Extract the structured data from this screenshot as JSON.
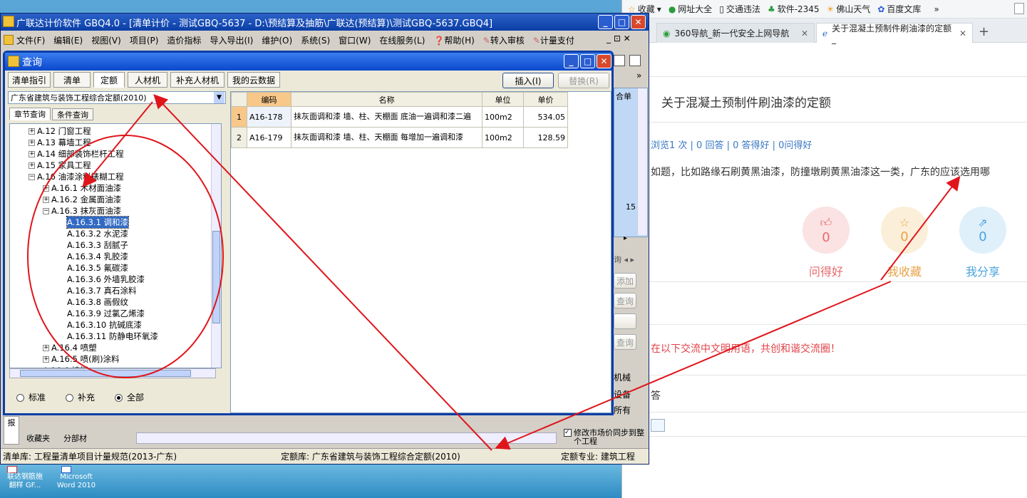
{
  "app": {
    "title": "广联达计价软件 GBQ4.0 - [清单计价 - 测试GBQ-5637 - D:\\预结算及抽筋\\广联达(预结算)\\测试GBQ-5637.GBQ4]",
    "menu": [
      "文件(F)",
      "编辑(E)",
      "视图(V)",
      "项目(P)",
      "造价指标",
      "导入导出(I)",
      "维护(O)",
      "系统(S)",
      "窗口(W)",
      "在线服务(L)",
      "帮助(H)",
      "转入审核",
      "计量支付"
    ],
    "status": {
      "qd_lib": "清单库: 工程量清单项目计量规范(2013-广东)",
      "de_lib": "定额库: 广东省建筑与装饰工程综合定额(2010)",
      "de_major": "定额专业: 建筑工程"
    },
    "bottom_tabs": [
      "收藏夹",
      "分部材"
    ],
    "side_right": {
      "label_he": "合单",
      "num": "15",
      "chaxun": "询",
      "tianjia": "添加",
      "chaxun2": "查询",
      "chaxun3": "查询",
      "radio_jixie": "机械",
      "radio_shebei": "设备",
      "radio_suoyou": "所有",
      "sync_label": "修改市场价同步到整个工程"
    },
    "left_vertical": "报"
  },
  "dialog": {
    "title": "查询",
    "tabs": [
      "清单指引",
      "清单",
      "定额",
      "人材机",
      "补充人材机",
      "我的云数据"
    ],
    "insert": "插入(I)",
    "replace": "替换(R)",
    "combo_value": "广东省建筑与装饰工程综合定额(2010)",
    "subtabs": [
      "章节查询",
      "条件查询"
    ],
    "tree": [
      {
        "label": "A.12 门窗工程",
        "lvl": 1,
        "tog": "+"
      },
      {
        "label": "A.13 幕墙工程",
        "lvl": 1,
        "tog": "+"
      },
      {
        "label": "A.14 细部装饰栏杆工程",
        "lvl": 1,
        "tog": "+"
      },
      {
        "label": "A.15 家具工程",
        "lvl": 1,
        "tog": "+"
      },
      {
        "label": "A.16 油漆涂料裱糊工程",
        "lvl": 1,
        "tog": "-"
      },
      {
        "label": "A.16.1 木材面油漆",
        "lvl": 2,
        "tog": "+"
      },
      {
        "label": "A.16.2 金属面油漆",
        "lvl": 2,
        "tog": "+"
      },
      {
        "label": "A.16.3 抹灰面油漆",
        "lvl": 2,
        "tog": "-"
      },
      {
        "label": "A.16.3.1 调和漆",
        "lvl": 3,
        "tog": "",
        "sel": true
      },
      {
        "label": "A.16.3.2 水泥漆",
        "lvl": 3,
        "tog": ""
      },
      {
        "label": "A.16.3.3 刮腻子",
        "lvl": 3,
        "tog": ""
      },
      {
        "label": "A.16.3.4 乳胶漆",
        "lvl": 3,
        "tog": ""
      },
      {
        "label": "A.16.3.5 氟碳漆",
        "lvl": 3,
        "tog": ""
      },
      {
        "label": "A.16.3.6 外墙乳胶漆",
        "lvl": 3,
        "tog": ""
      },
      {
        "label": "A.16.3.7 真石涂料",
        "lvl": 3,
        "tog": ""
      },
      {
        "label": "A.16.3.8 画假纹",
        "lvl": 3,
        "tog": ""
      },
      {
        "label": "A.16.3.9 过氯乙烯漆",
        "lvl": 3,
        "tog": ""
      },
      {
        "label": "A.16.3.10 抗碱底漆",
        "lvl": 3,
        "tog": ""
      },
      {
        "label": "A.16.3.11 防静电环氧漆",
        "lvl": 3,
        "tog": ""
      },
      {
        "label": "A.16.4 喷塑",
        "lvl": 2,
        "tog": "+"
      },
      {
        "label": "A.16.5 喷(刷)涂料",
        "lvl": 2,
        "tog": "+"
      },
      {
        "label": "A.16.6 裱糊",
        "lvl": 2,
        "tog": ""
      }
    ],
    "radios": [
      {
        "label": "标准",
        "on": false
      },
      {
        "label": "补充",
        "on": false
      },
      {
        "label": "全部",
        "on": true
      }
    ],
    "grid": {
      "headers": [
        "编码",
        "名称",
        "单位",
        "单价"
      ],
      "rows": [
        {
          "n": "1",
          "code": "A16-178",
          "name": "抹灰面调和漆 墙、柱、天棚面 底油一遍调和漆二遍",
          "unit": "100m2",
          "price": "534.05"
        },
        {
          "n": "2",
          "code": "A16-179",
          "name": "抹灰面调和漆 墙、柱、天棚面 每增加一遍调和漆",
          "unit": "100m2",
          "price": "128.59"
        }
      ]
    }
  },
  "desktop_icons": [
    {
      "label": "联达钢筋施\n翻样 GF..."
    },
    {
      "label": "Microsoft\nWord 2010"
    }
  ],
  "browser": {
    "bookmarks": [
      "收藏",
      "网址大全",
      "交通违法",
      "软件-2345",
      "佛山天气",
      "百度文库"
    ],
    "tabs": [
      {
        "label": "360导航_新一代安全上网导航",
        "active": false
      },
      {
        "label": "关于混凝土预制件刷油漆的定额_",
        "active": true
      }
    ],
    "question_title": "关于混凝土预制件刷油漆的定额",
    "meta": "浏览1 次 | 0 回答 | 0 答得好 | 0问得好",
    "body": "如题，比如路缘石刷黄黑油漆，防撞墩刷黄黑油漆这一类，广东的应该选用哪",
    "actions": [
      {
        "label": "问得好",
        "count": "0",
        "color": "#e66a6a",
        "bg": "#fbe3e3"
      },
      {
        "label": "我收藏",
        "count": "0",
        "color": "#e6a44a",
        "bg": "#fcefd9"
      },
      {
        "label": "我分享",
        "count": "0",
        "color": "#4aa3dc",
        "bg": "#dff0fb"
      }
    ],
    "notice": "在以下交流中文明用语，共创和谐交流圈！",
    "answer_label": "答"
  },
  "annotation_color": "#e0151b"
}
